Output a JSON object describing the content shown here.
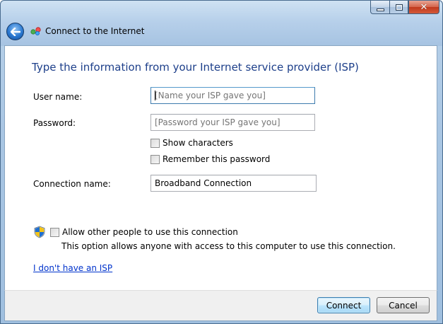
{
  "window": {
    "title": "Connect to the Internet",
    "caption_buttons": {
      "minimize_icon": "minimize-icon",
      "maximize_icon": "maximize-icon",
      "close_glyph": "✕"
    }
  },
  "heading": "Type the information from your Internet service provider (ISP)",
  "form": {
    "username": {
      "label": "User name:",
      "placeholder": "[Name your ISP gave you]",
      "value": ""
    },
    "password": {
      "label": "Password:",
      "placeholder": "[Password your ISP gave you]",
      "value": ""
    },
    "show_characters": {
      "label": "Show characters",
      "checked": false
    },
    "remember_password": {
      "label": "Remember this password",
      "checked": false
    },
    "connection_name": {
      "label": "Connection name:",
      "value": "Broadband Connection"
    }
  },
  "sharing": {
    "allow_others": {
      "label": "Allow other people to use this connection",
      "checked": false
    },
    "description": "This option allows anyone with access to this computer to use this connection."
  },
  "link_no_isp": "I don't have an ISP",
  "buttons": {
    "connect": "Connect",
    "cancel": "Cancel"
  },
  "colors": {
    "heading": "#1d3f8a",
    "link": "#0033cc",
    "default_button_border": "#3c7fb1"
  }
}
